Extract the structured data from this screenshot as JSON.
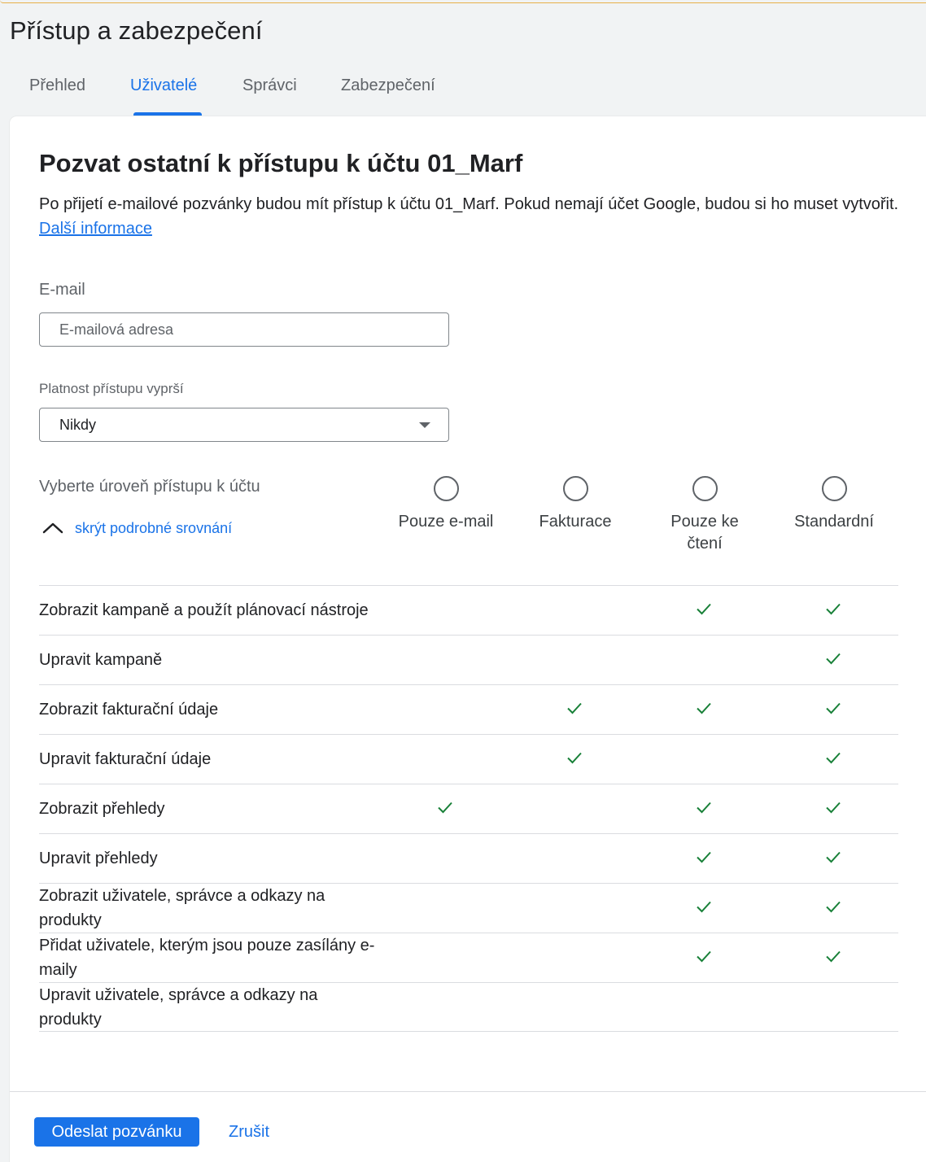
{
  "page": {
    "title": "Přístup a zabezpečení"
  },
  "tabs": [
    {
      "label": "Přehled"
    },
    {
      "label": "Uživatelé"
    },
    {
      "label": "Správci"
    },
    {
      "label": "Zabezpečení"
    }
  ],
  "active_tab": "Uživatelé",
  "invite": {
    "title": "Pozvat ostatní k přístupu k účtu 01_Marf",
    "description": "Po přijetí e-mailové pozvánky budou mít přístup k účtu 01_Marf. Pokud nemají účet Google, budou si ho muset vytvořit.",
    "more_link": "Další informace"
  },
  "email": {
    "label": "E-mail",
    "placeholder": "E-mailová adresa",
    "value": ""
  },
  "expiry": {
    "label": "Platnost přístupu vyprší",
    "value": "Nikdy"
  },
  "access_level": {
    "label": "Vyberte úroveň přístupu k účtu",
    "toggle_label": "skrýt podrobné srovnání",
    "options": [
      {
        "label": "Pouze e-mail",
        "selected": false
      },
      {
        "label": "Fakturace",
        "selected": false
      },
      {
        "label": "Pouze ke čtení",
        "selected": false
      },
      {
        "label": "Standardní",
        "selected": false
      }
    ]
  },
  "permissions": [
    {
      "label": "Zobrazit kampaně a použít plánovací nástroje",
      "checks": [
        false,
        false,
        true,
        true
      ]
    },
    {
      "label": "Upravit kampaně",
      "checks": [
        false,
        false,
        false,
        true
      ]
    },
    {
      "label": "Zobrazit fakturační údaje",
      "checks": [
        false,
        true,
        true,
        true
      ]
    },
    {
      "label": "Upravit fakturační údaje",
      "checks": [
        false,
        true,
        false,
        true
      ]
    },
    {
      "label": "Zobrazit přehledy",
      "checks": [
        true,
        false,
        true,
        true
      ]
    },
    {
      "label": "Upravit přehledy",
      "checks": [
        false,
        false,
        true,
        true
      ]
    },
    {
      "label": "Zobrazit uživatele, správce a odkazy na produkty",
      "checks": [
        false,
        false,
        true,
        true
      ]
    },
    {
      "label": "Přidat uživatele, kterým jsou pouze zasílány e-maily",
      "checks": [
        false,
        false,
        true,
        true
      ]
    },
    {
      "label": "Upravit uživatele, správce a odkazy na produkty",
      "checks": [
        false,
        false,
        false,
        false
      ]
    }
  ],
  "actions": {
    "send": "Odeslat pozvánku",
    "cancel": "Zrušit"
  },
  "colors": {
    "accent": "#1a73e8",
    "check": "#188038",
    "text": "#202124",
    "muted": "#5f6368"
  }
}
